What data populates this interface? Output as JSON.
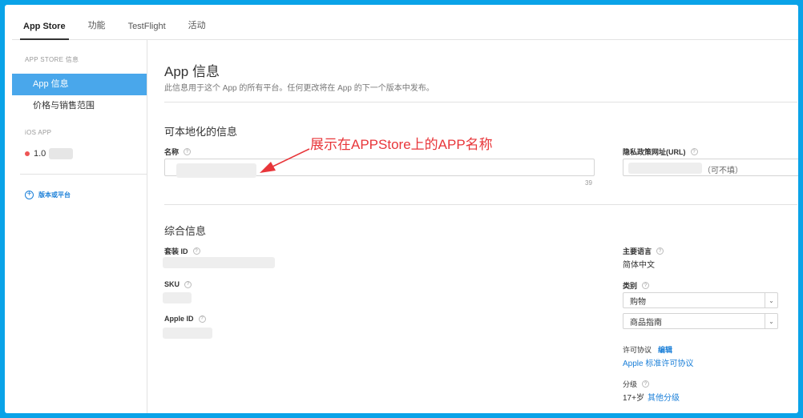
{
  "topnav": {
    "tabs": [
      {
        "label": "App Store"
      },
      {
        "label": "功能"
      },
      {
        "label": "TestFlight"
      },
      {
        "label": "活动"
      }
    ]
  },
  "sidebar": {
    "section_app_store": "APP STORE 信息",
    "items": [
      {
        "label": "App 信息"
      },
      {
        "label": "价格与销售范围"
      }
    ],
    "section_ios": "iOS APP",
    "version": "1.0",
    "add_platform": "版本或平台",
    "version_status_color": "#ee5555"
  },
  "main": {
    "title": "App 信息",
    "subtitle": "此信息用于这个 App 的所有平台。任何更改将在 App 的下一个版本中发布。",
    "localizable": {
      "heading": "可本地化的信息",
      "name_label": "名称",
      "name_counter": "39",
      "privacy_label": "隐私政策网址(URL)",
      "privacy_placeholder": "（可不填）"
    },
    "general": {
      "heading": "综合信息",
      "bundle_label": "套装 ID",
      "sku_label": "SKU",
      "apple_id_label": "Apple ID",
      "primary_lang_label": "主要语言",
      "primary_lang_value": "简体中文",
      "category_label": "类别",
      "category_primary": "购物",
      "category_secondary": "商品指南",
      "license_label": "许可协议",
      "license_edit": "编辑",
      "license_value": "Apple 标准许可协议",
      "rating_label": "分级",
      "rating_value": "17+岁",
      "rating_link": "其他分级"
    },
    "annotation": "展示在APPStore上的APP名称",
    "annotation_color": "#e8363a",
    "accent_color": "#1a7fd8",
    "active_item_color": "#49a7eb"
  }
}
